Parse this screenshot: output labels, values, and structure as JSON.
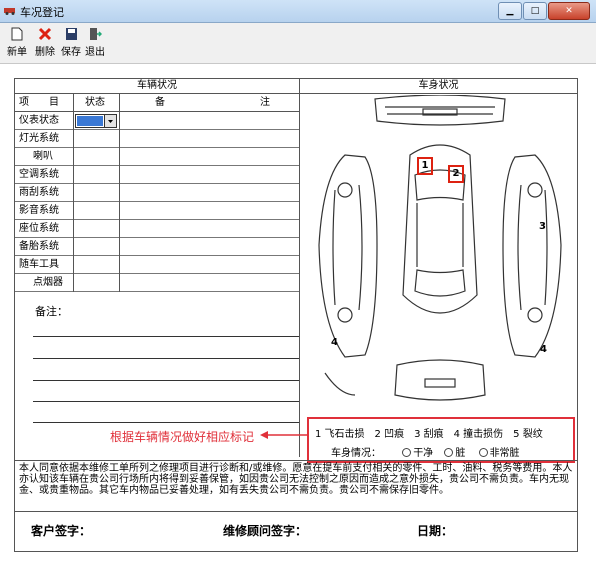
{
  "window": {
    "title": "车况登记"
  },
  "toolbar": {
    "new_label": "新单",
    "delete_label": "删除",
    "save_label": "保存",
    "exit_label": "退出"
  },
  "vehicle_status": {
    "section_title": "车辆状况",
    "col_item": "项　　目",
    "col_state": "状态",
    "col_note_a": "备",
    "col_note_b": "注",
    "items": [
      "仪表状态",
      "灯光系统",
      "喇叭",
      "空调系统",
      "雨刮系统",
      "影音系统",
      "座位系统",
      "备胎系统",
      "随车工具",
      "点烟器"
    ],
    "remark_label": "备注："
  },
  "body_status": {
    "section_title": "车身状况",
    "markers": [
      "1",
      "2",
      "3",
      "4",
      "4"
    ]
  },
  "hint": {
    "text": "根据车辆情况做好相应标记"
  },
  "legend": {
    "damage_types": "1 飞石击损　2 凹痕　3 刮痕　4 撞击损伤　5 裂纹",
    "cond_label": "车身情况：",
    "opt_clean": "干净",
    "opt_dirty": "脏",
    "opt_very_dirty": "非常脏"
  },
  "disclaimer": "本人同意依据本维修工单所列之修理项目进行诊断和/或维修。愿意在提车前支付相关的零件、工时、油料、税务等费用。本人亦认知该车辆在贵公司行场所内将得到妥善保管，如因贵公司无法控制之原因而造成之意外损失，贵公司不需负责。车内无现金、或贵重物品。其它车内物品已妥善处理，如有丢失贵公司不需负责。贵公司不需保存旧零件。",
  "signatures": {
    "customer": "客户签字：",
    "advisor": "维修顾问签字：",
    "date": "日期："
  }
}
